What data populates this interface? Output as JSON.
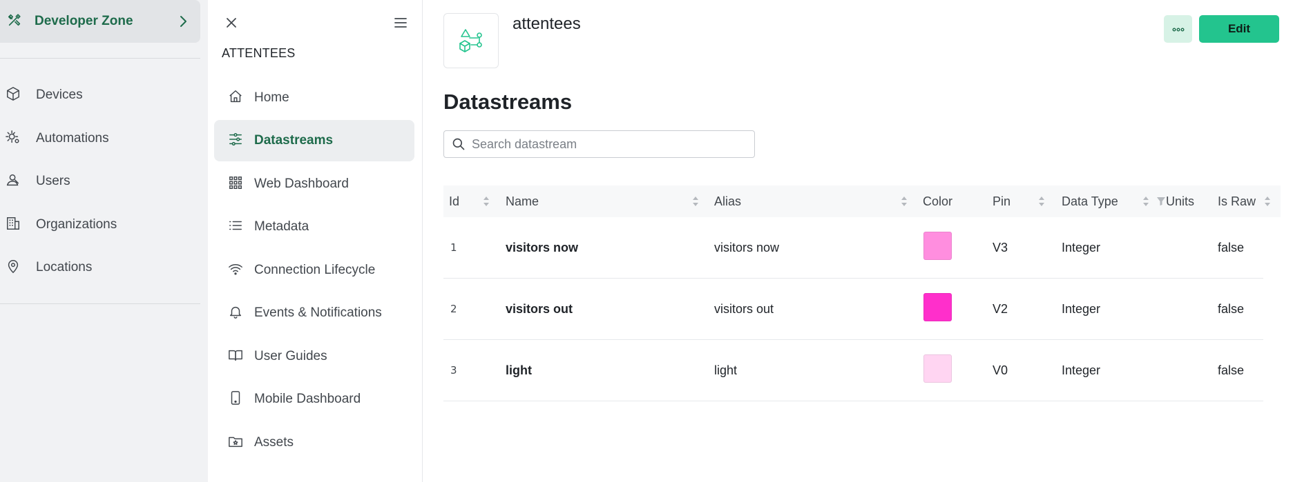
{
  "global_sidebar": {
    "developer_zone": {
      "label": "Developer Zone",
      "icon": "tools-icon"
    },
    "items": [
      {
        "label": "Devices",
        "icon": "cube-icon"
      },
      {
        "label": "Automations",
        "icon": "sun-gear-icon"
      },
      {
        "label": "Users",
        "icon": "user-icon"
      },
      {
        "label": "Organizations",
        "icon": "building-icon"
      },
      {
        "label": "Locations",
        "icon": "location-pin-icon"
      }
    ]
  },
  "product_sidebar": {
    "title": "ATTENTEES",
    "items": [
      {
        "label": "Home",
        "icon": "home-icon",
        "active": false
      },
      {
        "label": "Datastreams",
        "icon": "sliders-icon",
        "active": true
      },
      {
        "label": "Web Dashboard",
        "icon": "grid-icon",
        "active": false
      },
      {
        "label": "Metadata",
        "icon": "list-icon",
        "active": false
      },
      {
        "label": "Connection Lifecycle",
        "icon": "wifi-icon",
        "active": false
      },
      {
        "label": "Events & Notifications",
        "icon": "bell-icon",
        "active": false
      },
      {
        "label": "User Guides",
        "icon": "book-icon",
        "active": false
      },
      {
        "label": "Mobile Dashboard",
        "icon": "phone-icon",
        "active": false
      },
      {
        "label": "Assets",
        "icon": "folder-star-icon",
        "active": false
      }
    ]
  },
  "header": {
    "product_name": "attentees",
    "edit_label": "Edit",
    "more_icon": "ellipsis-icon"
  },
  "page": {
    "title": "Datastreams",
    "search_placeholder": "Search datastream"
  },
  "table": {
    "columns": [
      "Id",
      "Name",
      "Alias",
      "Color",
      "Pin",
      "Data Type",
      "Units",
      "Is Raw"
    ],
    "rows": [
      {
        "id": "1",
        "name": "visitors now",
        "alias": "visitors now",
        "color": "#ff8edf",
        "pin": "V3",
        "data_type": "Integer",
        "units": "",
        "is_raw": "false"
      },
      {
        "id": "2",
        "name": "visitors out",
        "alias": "visitors out",
        "color": "#ff2fcb",
        "pin": "V2",
        "data_type": "Integer",
        "units": "",
        "is_raw": "false"
      },
      {
        "id": "3",
        "name": "light",
        "alias": "light",
        "color": "#ffd5f2",
        "pin": "V0",
        "data_type": "Integer",
        "units": "",
        "is_raw": "false"
      }
    ]
  },
  "colors": {
    "accent": "#23c48e",
    "accent_text": "#1e6b4b",
    "sidebar_bg": "#f1f2f4"
  }
}
